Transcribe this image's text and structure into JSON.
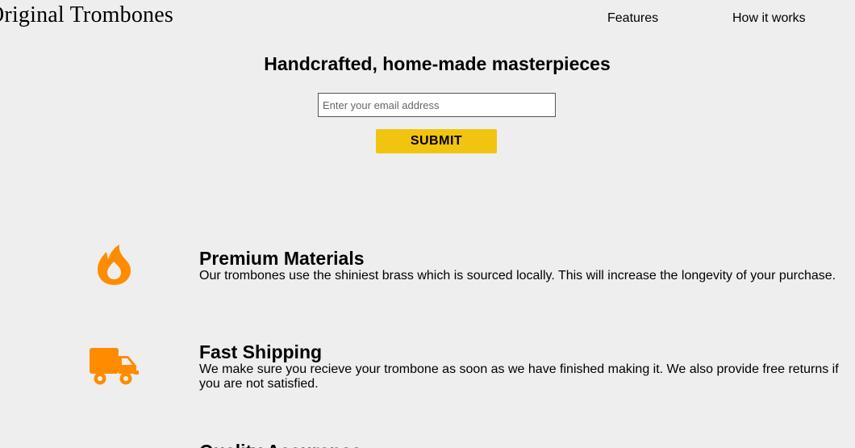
{
  "header": {
    "logo_text": "Original Trombones",
    "nav": {
      "features": "Features",
      "how_it_works": "How it works"
    }
  },
  "hero": {
    "title": "Handcrafted, home-made masterpieces",
    "email_placeholder": "Enter your email address",
    "submit_label": "SUBMIT"
  },
  "features": {
    "items": [
      {
        "icon": "fire-icon",
        "title": "Premium Materials",
        "description": "Our trombones use the shiniest brass which is sourced locally. This will increase the longevity of your purchase."
      },
      {
        "icon": "truck-icon",
        "title": "Fast Shipping",
        "description": "We make sure you recieve your trombone as soon as we have finished making it. We also provide free returns if you are not satisfied."
      },
      {
        "title": "Quality Assurance"
      }
    ]
  },
  "colors": {
    "background": "#eeeeee",
    "accent_yellow": "#f1c40f",
    "icon_orange": "#ff8c00"
  }
}
